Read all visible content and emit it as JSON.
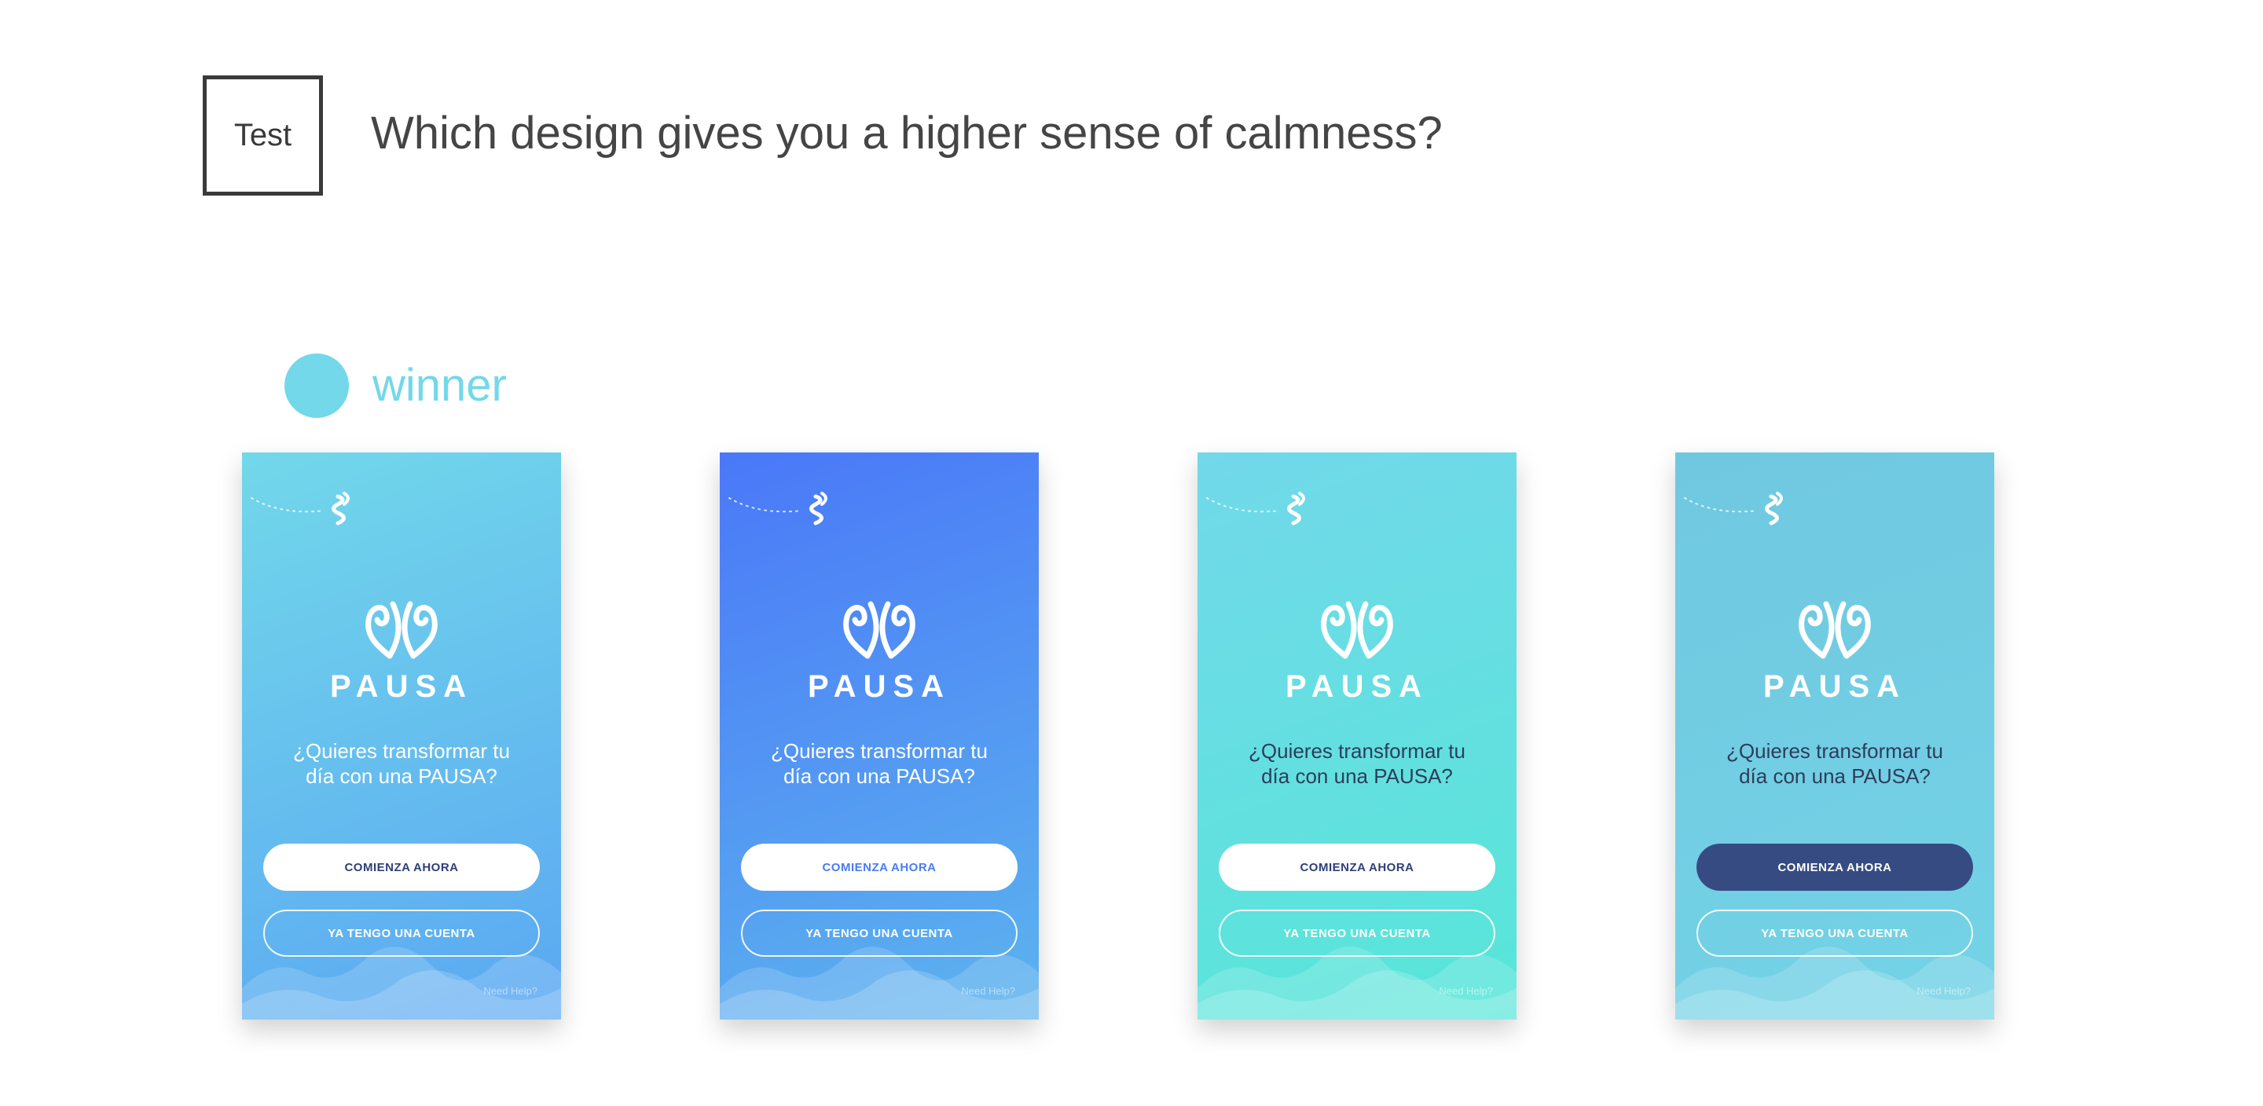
{
  "header": {
    "badge": "Test",
    "question": "Which design gives you a higher sense of calmness?"
  },
  "winner": {
    "label": "winner",
    "color": "#72d8ea"
  },
  "designs": [
    {
      "brand": "PAUSA",
      "tagline_line1": "¿Quieres transformar tu",
      "tagline_line2": "día con una PAUSA?",
      "primary_label": "COMIENZA AHORA",
      "secondary_label": "YA TENGO UNA CUENTA",
      "help": "Need Help?",
      "gradient": [
        "#72d8ea",
        "#5aa7f2"
      ],
      "primary_bg": "#ffffff",
      "primary_text": "#2f3f78",
      "tagline_color": "#ffffff"
    },
    {
      "brand": "PAUSA",
      "tagline_line1": "¿Quieres transformar tu",
      "tagline_line2": "día con una PAUSA?",
      "primary_label": "COMIENZA AHORA",
      "secondary_label": "YA TENGO UNA CUENTA",
      "help": "Need Help?",
      "gradient": [
        "#4a78f8",
        "#5cb4ee"
      ],
      "primary_bg": "#ffffff",
      "primary_text": "#4a7cf0",
      "tagline_color": "#ffffff"
    },
    {
      "brand": "PAUSA",
      "tagline_line1": "¿Quieres transformar tu",
      "tagline_line2": "día con una PAUSA?",
      "primary_label": "COMIENZA AHORA",
      "secondary_label": "YA TENGO UNA CUENTA",
      "help": "Need Help?",
      "gradient": [
        "#72d8ea",
        "#56e6d8"
      ],
      "primary_bg": "#ffffff",
      "primary_text": "#2f3f78",
      "tagline_color": "#2d3d5c"
    },
    {
      "brand": "PAUSA",
      "tagline_line1": "¿Quieres transformar tu",
      "tagline_line2": "día con una PAUSA?",
      "primary_label": "COMIENZA AHORA",
      "secondary_label": "YA TENGO UNA CUENTA",
      "help": "Need Help?",
      "gradient": [
        "#6fc8e0",
        "#74d3e6"
      ],
      "primary_bg": "#364b82",
      "primary_text": "#ffffff",
      "tagline_color": "#2d3d5c"
    }
  ]
}
